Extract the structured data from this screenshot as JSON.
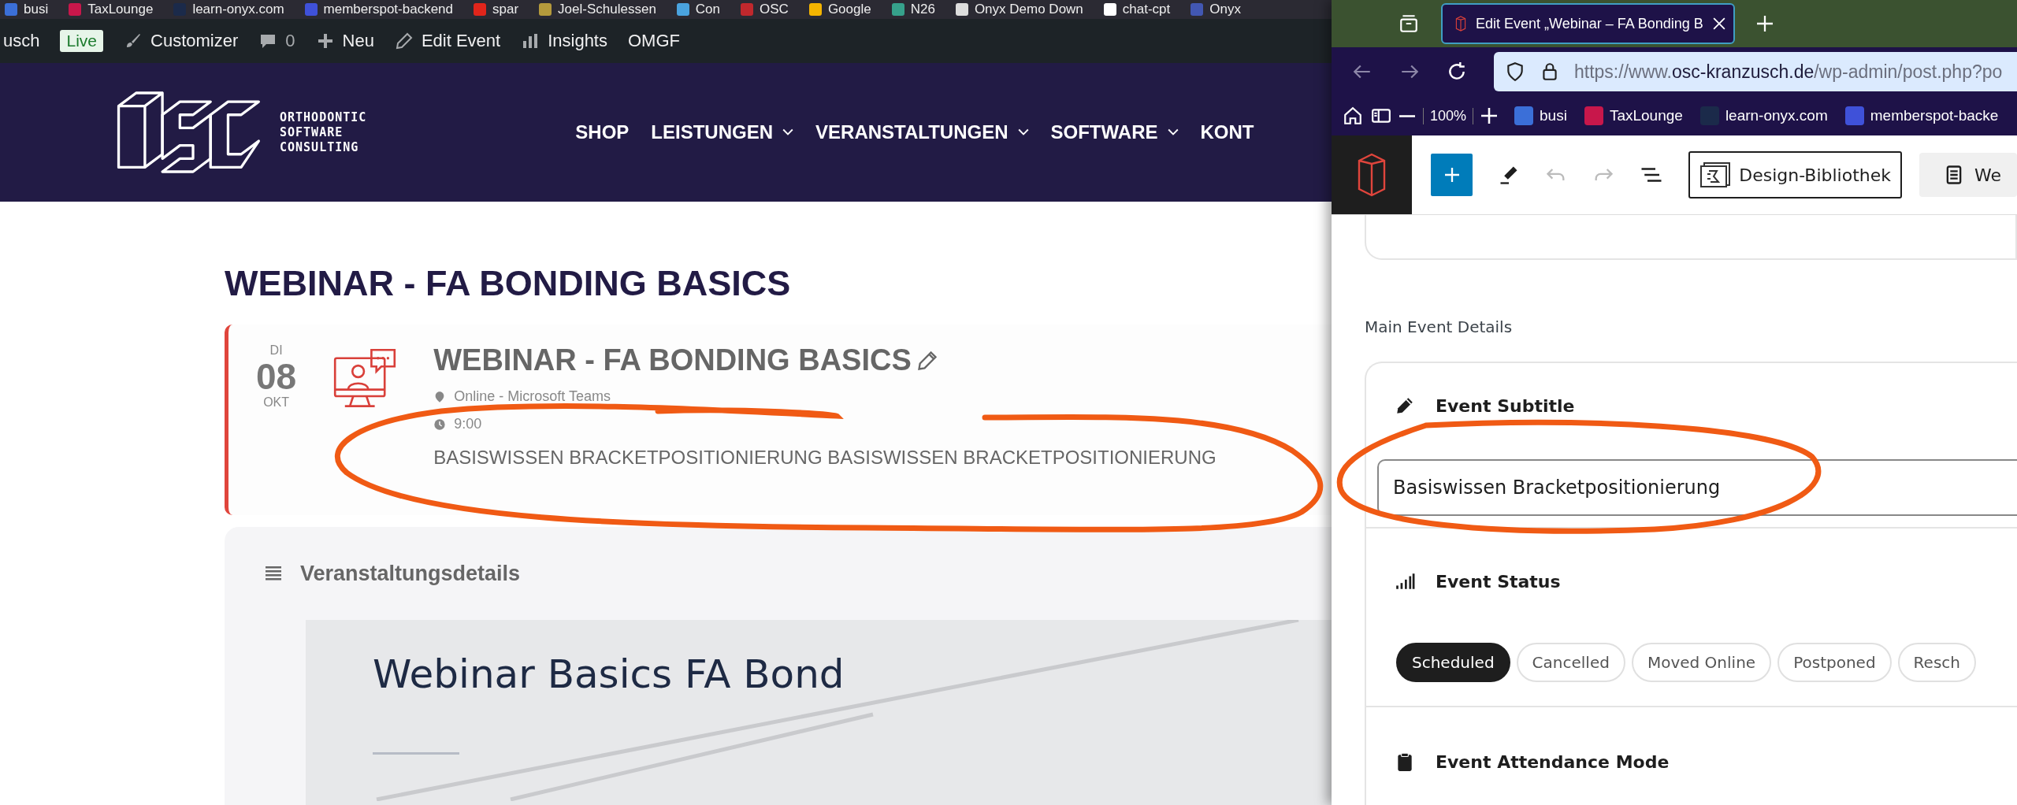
{
  "left_page": {
    "bookmarks": [
      {
        "label": "busi",
        "color": "#3b6fd8"
      },
      {
        "label": "TaxLounge",
        "color": "#c8174b"
      },
      {
        "label": "learn-onyx.com",
        "color": "#1b2a4a"
      },
      {
        "label": "memberspot-backend",
        "color": "#3f51d9"
      },
      {
        "label": "spar",
        "color": "#e1251b"
      },
      {
        "label": "Joel-Schulessen",
        "color": "#b59a3c"
      },
      {
        "label": "Con",
        "color": "#4aa3df"
      },
      {
        "label": "OSC",
        "color": "#c0282d"
      },
      {
        "label": "Google",
        "color": "#f4b400"
      },
      {
        "label": "N26",
        "color": "#36a18b"
      },
      {
        "label": "Onyx Demo Down",
        "color": "#dddddd"
      },
      {
        "label": "chat-cpt",
        "color": "#ffffff"
      },
      {
        "label": "Onyx",
        "color": "#4257b2"
      }
    ],
    "admin_bar": [
      {
        "kind": "text",
        "label": "usch"
      },
      {
        "kind": "badge",
        "label": "Live"
      },
      {
        "kind": "brush",
        "label": "Customizer"
      },
      {
        "kind": "comment",
        "label": "0"
      },
      {
        "kind": "plus",
        "label": "Neu"
      },
      {
        "kind": "pencil",
        "label": "Edit Event"
      },
      {
        "kind": "bars",
        "label": "Insights"
      },
      {
        "kind": "text",
        "label": "OMGF"
      }
    ],
    "logo_lines": [
      "ORTHODONTIC",
      "SOFTWARE",
      "CONSULTING"
    ],
    "menu": [
      {
        "label": "SHOP",
        "dropdown": false
      },
      {
        "label": "LEISTUNGEN",
        "dropdown": true
      },
      {
        "label": "VERANSTALTUNGEN",
        "dropdown": true
      },
      {
        "label": "SOFTWARE",
        "dropdown": true
      },
      {
        "label": "KONT",
        "dropdown": false
      }
    ],
    "page_title": "WEBINAR - FA BONDING BASICS",
    "event": {
      "weekday": "DI",
      "day": "08",
      "month": "OKT",
      "title": "WEBINAR - FA BONDING BASICS",
      "location": "Online - Microsoft Teams",
      "time": "9:00",
      "subtitle": "BASISWISSEN BRACKETPOSITIONIERUNG BASISWISSEN BRACKETPOSITIONIERUNG"
    },
    "details": {
      "heading": "Veranstaltungsdetails",
      "banner_title": "Webinar Basics FA Bond"
    }
  },
  "right_window": {
    "tab": {
      "title": "Edit Event „Webinar – FA Bonding B",
      "selected": true
    },
    "url": {
      "prefix": "https://www.",
      "domain": "osc-kranzusch.de",
      "path": "/wp-admin/post.php?po"
    },
    "zoom": "100%",
    "bookmarks": [
      {
        "label": "busi",
        "color": "#3b6fd8"
      },
      {
        "label": "TaxLounge",
        "color": "#c8174b"
      },
      {
        "label": "learn-onyx.com",
        "color": "#1b2a4a"
      },
      {
        "label": "memberspot-backe",
        "color": "#3f51d9"
      }
    ],
    "toolbar": {
      "library": "Design-Bibliothek",
      "cut_button": "We"
    },
    "section_title": "Main Event Details",
    "fields": [
      {
        "kind": "text",
        "label": "Event Subtitle",
        "value": "Basiswissen Bracketpositionierung"
      },
      {
        "kind": "status",
        "label": "Event Status",
        "options": [
          {
            "label": "Scheduled",
            "selected": true
          },
          {
            "label": "Cancelled",
            "selected": false
          },
          {
            "label": "Moved Online",
            "selected": false
          },
          {
            "label": "Postponed",
            "selected": false
          },
          {
            "label": "Resch",
            "selected": false
          }
        ]
      },
      {
        "kind": "attendance",
        "label": "Event Attendance Mode"
      }
    ]
  }
}
